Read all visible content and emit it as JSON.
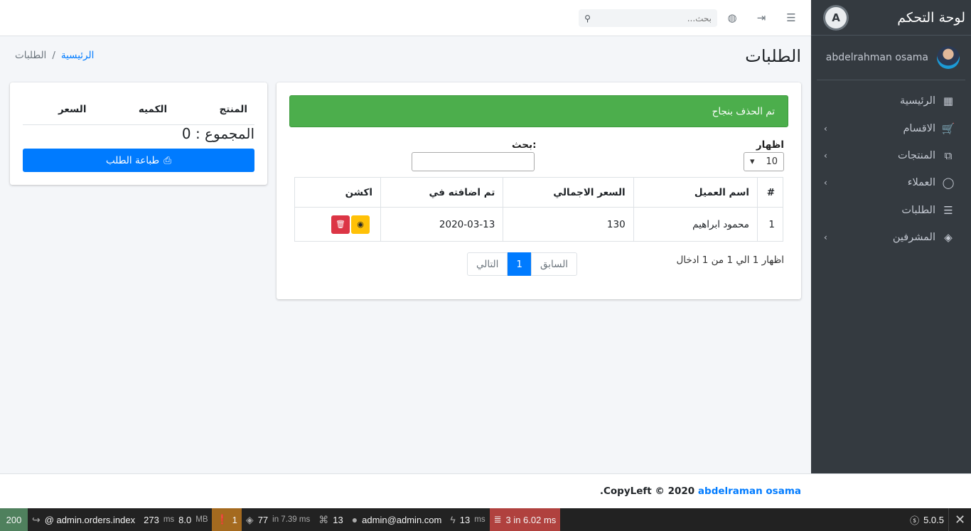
{
  "sidebar": {
    "brand": "لوحة التحكم",
    "brand_logo_letter": "A",
    "user_name": "abdelrahman osama",
    "items": [
      {
        "label": "الرئيسية",
        "icon": "grid-icon",
        "glyph": "▦",
        "arrow": ""
      },
      {
        "label": "الاقسام",
        "icon": "cart-icon",
        "glyph": "🛒",
        "arrow": "‹"
      },
      {
        "label": "المنتجات",
        "icon": "basket-icon",
        "glyph": "⧉",
        "arrow": "‹"
      },
      {
        "label": "العملاء",
        "icon": "user-icon",
        "glyph": "◯",
        "arrow": "‹"
      },
      {
        "label": "الطلبات",
        "icon": "list-icon",
        "glyph": "☰",
        "arrow": ""
      },
      {
        "label": "المشرفين",
        "icon": "user-secret-icon",
        "glyph": "◈",
        "arrow": "‹"
      }
    ]
  },
  "navbar": {
    "search_placeholder": "بحث..."
  },
  "page": {
    "title": "الطلبات",
    "breadcrumb_home": "الرئيسية",
    "breadcrumb_sep": "/",
    "breadcrumb_current": "الطلبات"
  },
  "orders": {
    "alert": "تم الحذف بنجاح",
    "show_label": "اظهار",
    "page_length": "10",
    "search_label": "بحث:",
    "columns": [
      "#",
      "اسم العميل",
      "السعر الاجمالي",
      "تم اضافته في",
      "اكشن"
    ],
    "rows": [
      {
        "num": "1",
        "client": "محمود ابراهيم",
        "total": "130",
        "date": "2020-03-13"
      }
    ],
    "info": "اظهار 1 الي 1 من 1 ادخال",
    "prev": "السابق",
    "page": "1",
    "next": "التالي"
  },
  "cart": {
    "col_product": "المنتج",
    "col_qty": "الكميه",
    "col_price": "السعر",
    "total": "المجموع : 0",
    "print": "طباعة الطلب"
  },
  "footer": {
    "prefix": "CopyLeft © 2020",
    "author": "abdelraman osama",
    "suffix": "."
  },
  "debug": {
    "status": "200",
    "route": "@ admin.orders.index",
    "time": "273",
    "time_unit": "ms",
    "memory": "8.0",
    "memory_unit": "MB",
    "warnings": "1",
    "views": "77",
    "views_suffix": "in 7.39 ms",
    "translations": "13",
    "user": "admin@admin.com",
    "events": "13",
    "events_unit": "ms",
    "queries": "3 in 6.02 ms",
    "version": "5.0.5"
  }
}
